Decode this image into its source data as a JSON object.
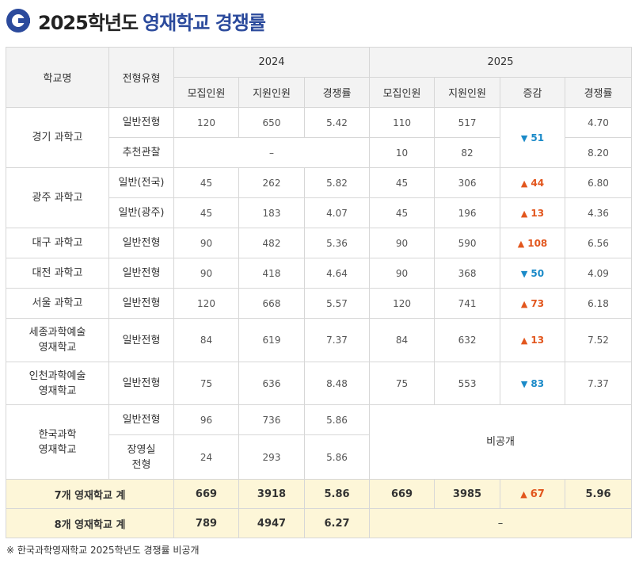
{
  "title": {
    "year": "2025학년도",
    "rest": "영재학교 경쟁률"
  },
  "headers": {
    "school": "학교명",
    "type": "전형유형",
    "year_2024": "2024",
    "year_2025": "2025",
    "recruit": "모집인원",
    "apply": "지원인원",
    "rate": "경쟁률",
    "change": "증감"
  },
  "rows": [
    {
      "school": "경기 과학고",
      "type": "일반전형",
      "r24": "120",
      "a24": "650",
      "c24": "5.42",
      "r25": "110",
      "a25": "517",
      "delta": "51",
      "dir": "down",
      "c25": "4.70"
    },
    {
      "type": "추천관찰",
      "dash": "–",
      "r25": "10",
      "a25": "82",
      "c25": "8.20"
    },
    {
      "school": "광주 과학고",
      "type": "일반(전국)",
      "r24": "45",
      "a24": "262",
      "c24": "5.82",
      "r25": "45",
      "a25": "306",
      "delta": "44",
      "dir": "up",
      "c25": "6.80"
    },
    {
      "type": "일반(광주)",
      "r24": "45",
      "a24": "183",
      "c24": "4.07",
      "r25": "45",
      "a25": "196",
      "delta": "13",
      "dir": "up",
      "c25": "4.36"
    },
    {
      "school": "대구 과학고",
      "type": "일반전형",
      "r24": "90",
      "a24": "482",
      "c24": "5.36",
      "r25": "90",
      "a25": "590",
      "delta": "108",
      "dir": "up",
      "c25": "6.56"
    },
    {
      "school": "대전 과학고",
      "type": "일반전형",
      "r24": "90",
      "a24": "418",
      "c24": "4.64",
      "r25": "90",
      "a25": "368",
      "delta": "50",
      "dir": "down",
      "c25": "4.09"
    },
    {
      "school": "서울 과학고",
      "type": "일반전형",
      "r24": "120",
      "a24": "668",
      "c24": "5.57",
      "r25": "120",
      "a25": "741",
      "delta": "73",
      "dir": "up",
      "c25": "6.18"
    },
    {
      "school_l1": "세종과학예술",
      "school_l2": "영재학교",
      "type": "일반전형",
      "r24": "84",
      "a24": "619",
      "c24": "7.37",
      "r25": "84",
      "a25": "632",
      "delta": "13",
      "dir": "up",
      "c25": "7.52"
    },
    {
      "school_l1": "인천과학예술",
      "school_l2": "영재학교",
      "type": "일반전형",
      "r24": "75",
      "a24": "636",
      "c24": "8.48",
      "r25": "75",
      "a25": "553",
      "delta": "83",
      "dir": "down",
      "c25": "7.37"
    },
    {
      "school_l1": "한국과학",
      "school_l2": "영재학교",
      "type": "일반전형",
      "r24": "96",
      "a24": "736",
      "c24": "5.86",
      "undisclosed": "비공개"
    },
    {
      "type_l1": "장영실",
      "type_l2": "전형",
      "r24": "24",
      "a24": "293",
      "c24": "5.86"
    }
  ],
  "totals": [
    {
      "label": "7개 영재학교 계",
      "r24": "669",
      "a24": "3918",
      "c24": "5.86",
      "r25": "669",
      "a25": "3985",
      "delta": "67",
      "dir": "up",
      "c25": "5.96"
    },
    {
      "label": "8개 영재학교 계",
      "r24": "789",
      "a24": "4947",
      "c24": "6.27",
      "dash": "–"
    }
  ],
  "arrows": {
    "up": "▲",
    "down": "▼"
  },
  "footnote": "※ 한국과학영재학교 2025학년도 경쟁률 비공개",
  "colors": {
    "brand": "#2b4a9c",
    "up": "#e2561d",
    "down": "#1a8ac8",
    "total_bg": "#fdf6d8",
    "header_bg": "#f3f3f3"
  }
}
